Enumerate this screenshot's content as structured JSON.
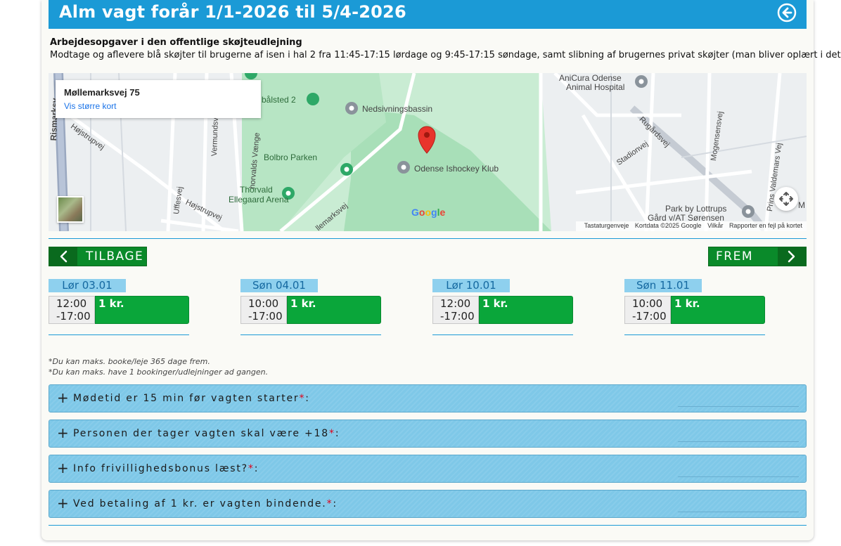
{
  "header": {
    "title": "Alm vagt forår 1/1-2026 til 5/4-2026",
    "back_icon": "circle-arrow-left-icon"
  },
  "description": {
    "title": "Arbejdesopgaver i den offentlige skøjteudlejning",
    "text": "Modtage og aflevere blå skøjter til brugerne af isen i hal 2 fra 11:45-17:15 lørdage og 9:45-17:15 søndage, samt slibning af brugernes privat skøjter (man bliver oplært i dette)"
  },
  "map": {
    "popup_title": "Møllemarksvej 75",
    "popup_link": "Vis større kort",
    "labels": {
      "anicura": "AniCura Odense",
      "anicura2": "Animal Hospital",
      "balsted": "bålsted 2",
      "nedsivning": "Nedsivningsbassin",
      "bolbro": "Bolbro Parken",
      "ishockey": "Odense Ishockey Klub",
      "thorvald": "Thorvald",
      "ellegaard": "Ellegaard Arena",
      "risby": "Rismarksv",
      "hojstrup": "Højstrupvej",
      "hojstrup2": "Højstrupvej",
      "vermund": "Vermundsvej",
      "uffes": "Uffesvej",
      "thorvalds": "horvalds Vænge",
      "mollemarks": "llemarksvej",
      "rugard": "Rugårdsvej",
      "stadion": "Stadionvej",
      "mogensen": "Mogensensvej",
      "prins": "Prins Valdemars Vej",
      "park": "Park by Lottrups",
      "park2": "Gård v/AT Sørensen",
      "m": "M"
    },
    "google": "Google",
    "attribution": [
      "Tastaturgenveje",
      "Kortdata ©2025 Google",
      "Vilkår",
      "Rapporter en fejl på kortet"
    ],
    "colors": {
      "park": "#a8dfb8",
      "road": "#ffffff",
      "land": "#eceff1",
      "pin": "#e8342c"
    }
  },
  "nav": {
    "back_label": "TILBAGE",
    "forward_label": "FREM"
  },
  "days": [
    {
      "label": "Lør 03.01",
      "time_start": "12:00",
      "time_end": "-17:00",
      "price": "1 kr."
    },
    {
      "label": "Søn 04.01",
      "time_start": "10:00",
      "time_end": "-17:00",
      "price": "1 kr."
    },
    {
      "label": "Lør 10.01",
      "time_start": "12:00",
      "time_end": "-17:00",
      "price": "1 kr."
    },
    {
      "label": "Søn 11.01",
      "time_start": "10:00",
      "time_end": "-17:00",
      "price": "1 kr."
    }
  ],
  "notes": [
    "*Du kan maks. booke/leje 365 dage frem.",
    "*Du kan maks. have 1 bookinger/udlejninger ad gangen."
  ],
  "accordion": [
    {
      "plus": "+",
      "text": "Mødetid er 15 min før vagten starter",
      "star": "*",
      "suffix": ":"
    },
    {
      "plus": "+",
      "text": "Personen der tager vagten skal være +18",
      "star": "*",
      "suffix": ":"
    },
    {
      "plus": "+",
      "text": "Info frivillighedsbonus læst?",
      "star": "*",
      "suffix": ":"
    },
    {
      "plus": "+",
      "text": "Ved betaling af 1 kr. er vagten bindende.",
      "star": "*",
      "suffix": ":"
    }
  ],
  "colors": {
    "accent": "#1b9ad6",
    "green": "#0aa63a",
    "accordion": "#7ec8e8",
    "required": "#e0001a"
  }
}
